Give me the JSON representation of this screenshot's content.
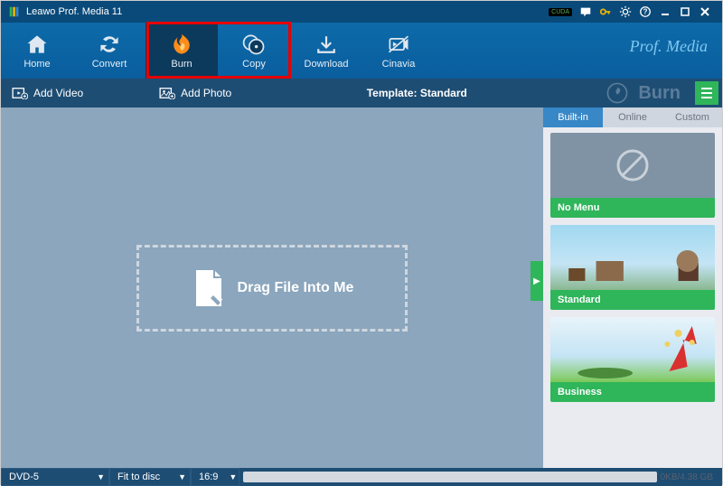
{
  "title": "Leawo Prof. Media 11",
  "brand": "Prof. Media",
  "nvbadge": "CUDA",
  "nav": {
    "home": "Home",
    "convert": "Convert",
    "burn": "Burn",
    "copy": "Copy",
    "download": "Download",
    "cinavia": "Cinavia"
  },
  "subbar": {
    "add_video": "Add Video",
    "add_photo": "Add Photo",
    "template_label": "Template: Standard",
    "burn": "Burn"
  },
  "dropzone": "Drag File Into Me",
  "side_tabs": {
    "builtin": "Built-in",
    "online": "Online",
    "custom": "Custom"
  },
  "templates": {
    "nomenu": "No Menu",
    "standard": "Standard",
    "business": "Business"
  },
  "bottom": {
    "disc": "DVD-5",
    "fit": "Fit to disc",
    "aspect": "16:9",
    "progress": "0KB/4.38 GB"
  }
}
